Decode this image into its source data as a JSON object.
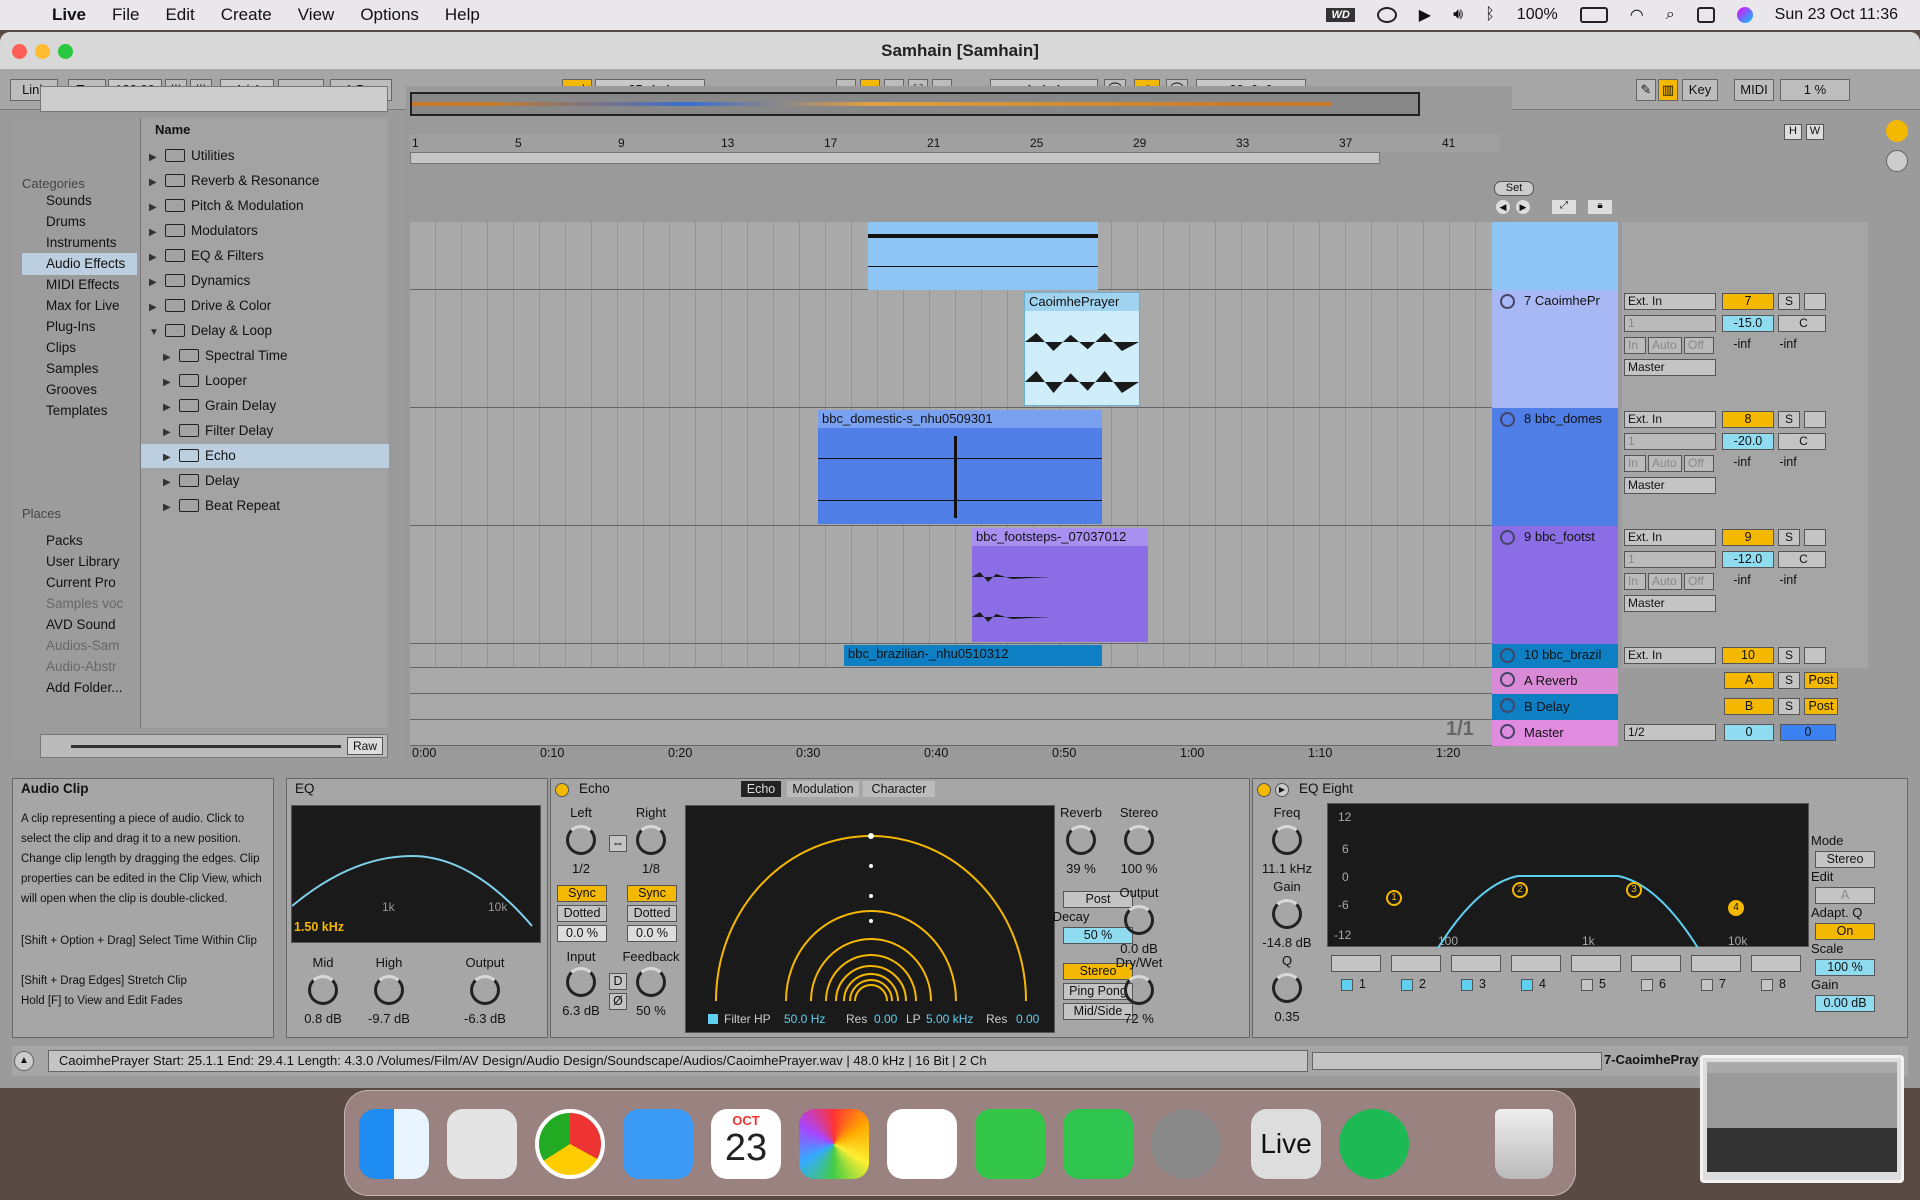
{
  "menubar": {
    "apple": "",
    "app": "Live",
    "items": [
      "File",
      "Edit",
      "Create",
      "View",
      "Options",
      "Help"
    ],
    "wd": "WD",
    "battery": "100%",
    "datetime": "Sun 23 Oct  11:36"
  },
  "window": {
    "title": "Samhain  [Samhain]"
  },
  "control": {
    "link": "Link",
    "tap": "Tap",
    "tempo": "120.00",
    "sig": "4 / 4",
    "quant": "1 Bar",
    "position": "25.   1.   1",
    "loop_start": "1.   1.   1",
    "loop_len": "38.   0.   0",
    "key": "Key",
    "midi": "MIDI",
    "cpu": "1 %",
    "h": "H",
    "w": "W"
  },
  "browser": {
    "categories_title": "Categories",
    "categories": [
      "Sounds",
      "Drums",
      "Instruments",
      "Audio Effects",
      "MIDI Effects",
      "Max for Live",
      "Plug-Ins",
      "Clips",
      "Samples",
      "Grooves",
      "Templates"
    ],
    "places_title": "Places",
    "places": [
      "Packs",
      "User Library",
      "Current Pro",
      "Samples voc",
      "AVD Sound",
      "Audios-Sam",
      "Audio-Abstr",
      "Add Folder..."
    ],
    "name_header": "Name",
    "folders": [
      "Utilities",
      "Reverb & Resonance",
      "Pitch & Modulation",
      "Modulators",
      "EQ & Filters",
      "Dynamics",
      "Drive & Color",
      "Delay & Loop"
    ],
    "subfolders": [
      "Spectral Time",
      "Looper",
      "Grain Delay",
      "Filter Delay",
      "Echo",
      "Delay",
      "Beat Repeat"
    ],
    "raw": "Raw"
  },
  "arrangement": {
    "bars": [
      "1",
      "5",
      "9",
      "13",
      "17",
      "21",
      "25",
      "29",
      "33",
      "37",
      "41"
    ],
    "times": [
      "0:00",
      "0:10",
      "0:20",
      "0:30",
      "0:40",
      "0:50",
      "1:00",
      "1:10",
      "1:20"
    ],
    "clips": [
      "CaoimhePrayer",
      "bbc_domestic-s_nhu0509301",
      "bbc_footsteps-_07037012",
      "bbc_brazilian-_nhu0510312"
    ],
    "set": "Set",
    "page": "1/1"
  },
  "tracks": [
    {
      "name": "7 CaoimhePr",
      "input": "Ext. In",
      "chan": "1",
      "num": "7",
      "vol": "-15.0",
      "pan": "C",
      "out": "Master"
    },
    {
      "name": "8 bbc_domes",
      "input": "Ext. In",
      "chan": "1",
      "num": "8",
      "vol": "-20.0",
      "pan": "C",
      "out": "Master"
    },
    {
      "name": "9 bbc_footst",
      "input": "Ext. In",
      "chan": "1",
      "num": "9",
      "vol": "-12.0",
      "pan": "C",
      "out": "Master"
    },
    {
      "name": "10 bbc_brazil",
      "input": "Ext. In",
      "num": "10"
    }
  ],
  "returns": [
    {
      "name": "A Reverb",
      "num": "A",
      "post": "Post"
    },
    {
      "name": "B Delay",
      "num": "B",
      "post": "Post"
    }
  ],
  "master": {
    "name": "Master",
    "cue": "1/2",
    "vol": "0",
    "pan": "0"
  },
  "mixer_common": {
    "in": "In",
    "auto": "Auto",
    "off": "Off",
    "inf": "-inf",
    "solo": "S",
    "master": "Master"
  },
  "info": {
    "title": "Audio Clip",
    "text": "A clip representing a piece of audio. Click to select the clip and drag it to a new position. Change clip length by dragging the edges. Clip properties can be edited in the Clip View, which will open when the clip is double-clicked.",
    "hint1": "[Shift + Option + Drag] Select Time Within Clip",
    "hint2": "[Shift + Drag Edges] Stretch Clip",
    "hint3": "Hold [F] to View and Edit Fades"
  },
  "eq_small": {
    "title": "EQ",
    "freq": "1.50 kHz",
    "axis": "1k",
    "axis2": "10k",
    "mid_label": "Mid",
    "mid": "0.8 dB",
    "high_label": "High",
    "high": "-9.7 dB",
    "out_label": "Output",
    "out": "-6.3 dB"
  },
  "echo": {
    "title": "Echo",
    "tabs": [
      "Echo",
      "Modulation",
      "Character"
    ],
    "left": "Left",
    "right": "Right",
    "left_val": "1/2",
    "right_val": "1/8",
    "sync": "Sync",
    "dotted": "Dotted",
    "pct": "0.0 %",
    "input": "Input",
    "input_val": "6.3 dB",
    "feedback": "Feedback",
    "feedback_val": "50 %",
    "d": "D",
    "reverb": "Reverb",
    "reverb_val": "39 %",
    "stereo": "Stereo",
    "stereo_val": "100 %",
    "post": "Post",
    "decay": "Decay",
    "decay_val": "50 %",
    "output": "Output",
    "output_val": "0.0 dB",
    "mode_stereo": "Stereo",
    "pingpong": "Ping Pong",
    "midside": "Mid/Side",
    "drywet": "Dry/Wet",
    "drywet_val": "72 %",
    "filter": "Filter HP",
    "hp": "50.0 Hz",
    "res1": "Res",
    "res1_val": "0.00",
    "lp_label": "LP",
    "lp": "5.00 kHz",
    "res2": "Res",
    "res2_val": "0.00"
  },
  "eq8": {
    "title": "EQ Eight",
    "freq": "Freq",
    "freq_val": "11.1 kHz",
    "gain": "Gain",
    "gain_val": "-14.8 dB",
    "q": "Q",
    "q_val": "0.35",
    "db": [
      "12",
      "6",
      "0",
      "-6",
      "-12"
    ],
    "hz": [
      "100",
      "1k",
      "10k"
    ],
    "bands": [
      "1",
      "2",
      "3",
      "4",
      "5",
      "6",
      "7",
      "8"
    ],
    "mode": "Mode",
    "mode_val": "Stereo",
    "edit": "Edit",
    "edit_val": "A",
    "adapt": "Adapt. Q",
    "adapt_val": "On",
    "scale": "Scale",
    "scale_val": "100 %",
    "gain2": "Gain",
    "gain2_val": "0.00 dB",
    "nodes": [
      "1",
      "2",
      "3",
      "4"
    ]
  },
  "status": {
    "text": "CaoimhePrayer  Start: 25.1.1  End: 29.4.1  Length: 4.3.0  /Volumes/Film/AV Design/Audio Design/Soundscape/Audios/CaoimhePrayer.wav | 48.0 kHz | 16 Bit | 2 Ch",
    "track": "7-CaoimhePray"
  },
  "dock": {
    "apps": [
      "Finder",
      "Launchpad",
      "Chrome",
      "Mail",
      "Calendar",
      "Photos",
      "Reminders",
      "Messages",
      "FaceTime",
      "System Preferences",
      "Live",
      "Spotify",
      "Trash"
    ],
    "cal_month": "OCT",
    "cal_day": "23",
    "live": "Live"
  }
}
